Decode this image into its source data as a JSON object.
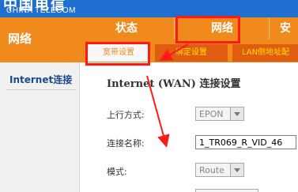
{
  "brand": {
    "logo_text_cn": "中国电信",
    "logo_text_en": "CHINA TELECOM"
  },
  "left_panel": {
    "title": "网络"
  },
  "main_tabs": [
    {
      "label": "状态"
    },
    {
      "label": "网络"
    },
    {
      "label": "安"
    }
  ],
  "sub_tabs": [
    {
      "label": "宽带设置"
    },
    {
      "label": "绑定设置"
    },
    {
      "label": "LAN侧地址配"
    }
  ],
  "sidebar": {
    "items": [
      {
        "label": "Internet连接"
      }
    ]
  },
  "content": {
    "section_title": "Internet (WAN) 连接设置",
    "fields": [
      {
        "label": "上行方式:",
        "value": "EPON"
      },
      {
        "label": "连接名称:",
        "value": "1_TR069_R_VID_46"
      },
      {
        "label": "模式:",
        "value": "Route"
      }
    ]
  },
  "colors": {
    "brand_blue": "#1e6fd0",
    "accent_orange": "#f08a1c",
    "annotation_red": "#ff1a1a"
  }
}
